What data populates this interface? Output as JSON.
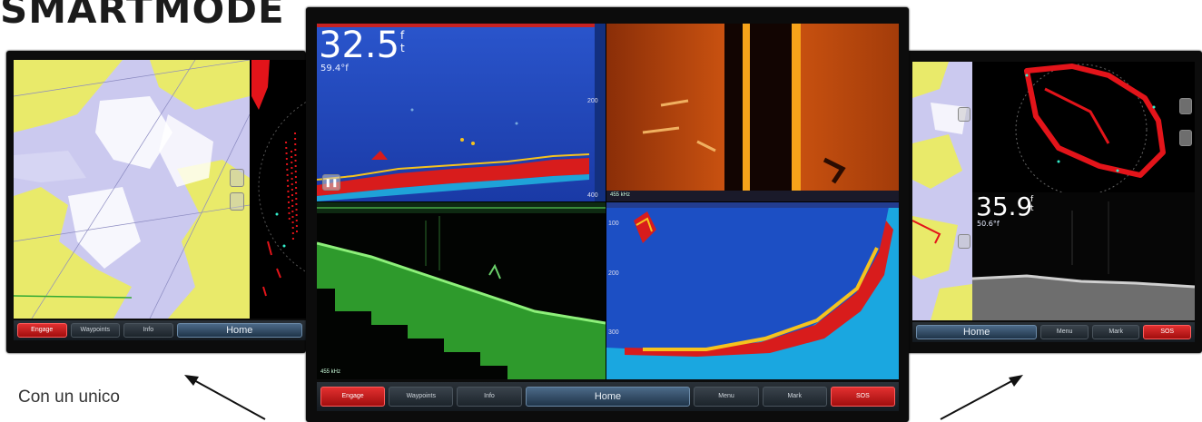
{
  "brand": {
    "title": "SMARTMODE"
  },
  "caption": {
    "text": "Con un unico"
  },
  "center_screen": {
    "depth": "32.5",
    "depth_unit_top": "f",
    "depth_unit_bottom": "t",
    "temperature": "59.4°f",
    "scale_labels": [
      "200",
      "400"
    ],
    "right_scale_labels": [
      "100",
      "200",
      "300"
    ],
    "freq_labels": [
      "455 kHz",
      "455 kHz"
    ],
    "toolbar": {
      "engage": "Engage",
      "waypoints": "Waypoints",
      "info": "Info",
      "home": "Home",
      "menu": "Menu",
      "mark": "Mark",
      "sos": "SOS"
    }
  },
  "left_screen": {
    "toolbar": {
      "engage": "Engage",
      "waypoints": "Waypoints",
      "info": "Info",
      "home": "Home"
    }
  },
  "right_screen": {
    "depth": "35.9",
    "depth_unit_top": "f",
    "depth_unit_bottom": "t",
    "temperature": "50.6°f",
    "toolbar": {
      "home": "Home",
      "menu": "Menu",
      "mark": "Mark",
      "sos": "SOS"
    }
  },
  "colors": {
    "accent_red": "#d91f1f",
    "home_blue": "#2f4d6b",
    "chart_yellow": "#e9ea6a",
    "chart_lavender": "#c9c8ee",
    "sonar_blue": "#1d45b8"
  }
}
